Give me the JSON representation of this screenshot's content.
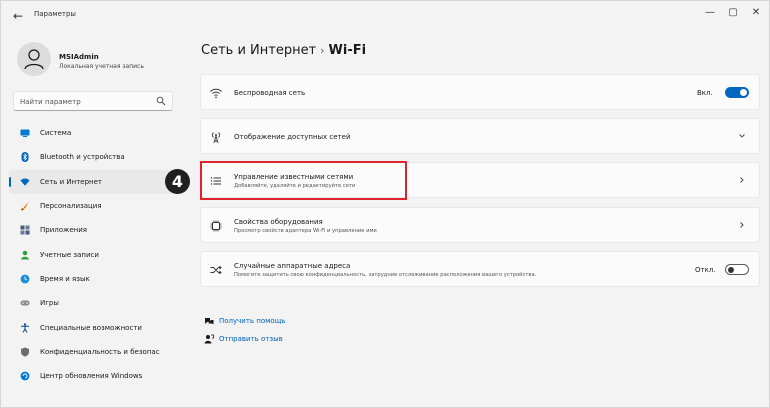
{
  "window": {
    "title": "Параметры",
    "back": "←",
    "minimize": "—",
    "maximize": "▢",
    "close": "✕"
  },
  "account": {
    "name": "MSIAdmin",
    "role": "Локальная учетная запись"
  },
  "search": {
    "placeholder": "Найти параметр"
  },
  "sidebar": {
    "items": [
      {
        "label": "Система",
        "icon": "monitor-icon",
        "color": "#0078d4"
      },
      {
        "label": "Bluetooth и устройства",
        "icon": "bluetooth-icon",
        "color": "#0067c0"
      },
      {
        "label": "Сеть и Интернет",
        "icon": "wifi-icon",
        "color": "#0067c0",
        "active": true
      },
      {
        "label": "Персонализация",
        "icon": "brush-icon",
        "color": "#e27b00"
      },
      {
        "label": "Приложения",
        "icon": "apps-icon",
        "color": "#4a5a7a"
      },
      {
        "label": "Учетные записи",
        "icon": "person-icon",
        "color": "#2ea043"
      },
      {
        "label": "Время и язык",
        "icon": "globe-clock-icon",
        "color": "#1b8fd6"
      },
      {
        "label": "Игры",
        "icon": "gamepad-icon",
        "color": "#8a8a8a"
      },
      {
        "label": "Специальные возможности",
        "icon": "accessibility-icon",
        "color": "#1d4f91"
      },
      {
        "label": "Конфиденциальность и безопас",
        "icon": "shield-icon",
        "color": "#6c6c6c"
      },
      {
        "label": "Центр обновления Windows",
        "icon": "update-icon",
        "color": "#0078d4"
      }
    ]
  },
  "breadcrumb": {
    "parent": "Сеть и Интернет",
    "separator": "›",
    "current": "Wi-Fi"
  },
  "cards": {
    "wireless": {
      "title": "Беспроводная сеть",
      "toggle_label": "Вкл.",
      "toggle_on": true
    },
    "available": {
      "title": "Отображение доступных сетей"
    },
    "known": {
      "title": "Управление известными сетями",
      "subtitle": "Добавляйте, удаляйте и редактируйте сети"
    },
    "hardware": {
      "title": "Свойства оборудования",
      "subtitle": "Просмотр свойств адаптера Wi-Fi и управление ими"
    },
    "random_mac": {
      "title": "Случайные аппаратные адреса",
      "subtitle": "Помогите защитить свою конфиденциальность, затруднив отслеживание расположения вашего устройства.",
      "toggle_label": "Откл.",
      "toggle_on": false
    }
  },
  "annotation": {
    "step": "4",
    "color": "#e0242d"
  },
  "help": {
    "get_help": "Получить помощь",
    "feedback": "Отправить отзыв"
  },
  "colors": {
    "accent": "#0067c0",
    "link": "#0060b8"
  }
}
